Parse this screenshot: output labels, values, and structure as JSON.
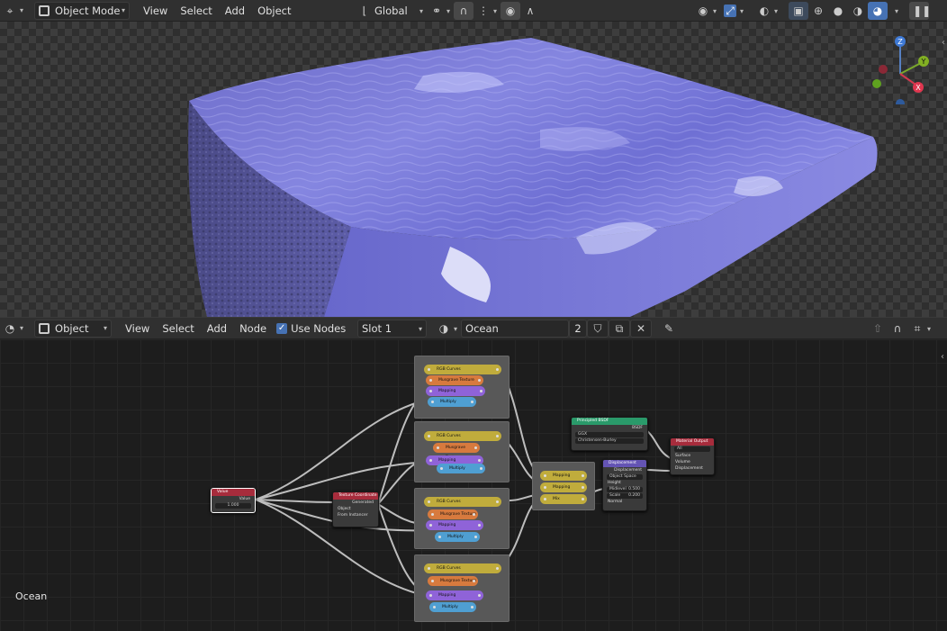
{
  "top_toolbar": {
    "editor_icon": "axis-cross-icon",
    "mode_label": "Object Mode",
    "menu": [
      "View",
      "Select",
      "Add",
      "Object"
    ],
    "transform_orientation": "Global"
  },
  "node_toolbar": {
    "mode_label": "Object",
    "menu": [
      "View",
      "Select",
      "Add",
      "Node"
    ],
    "use_nodes_label": "Use Nodes",
    "use_nodes_checked": true,
    "slot_label": "Slot 1",
    "material_name": "Ocean",
    "user_count": "2"
  },
  "node_editor": {
    "material_label": "Ocean",
    "colors": {
      "color_ramp": "#c0ac3c",
      "mix": "#d77a3e",
      "mapping": "#8f63d8",
      "math": "#4f9fd2"
    },
    "frame_nodes": [
      "RGB Curves",
      "Musgrave Texture",
      "Mapping",
      "Multiply"
    ],
    "value_node": {
      "title": "Value",
      "output": "Value",
      "value": "1.000"
    },
    "texture_coord_node": {
      "title": "Texture Coordinate",
      "output": "Generated",
      "object_label": "Object",
      "instancer_label": "From Instancer"
    },
    "mix_node": {
      "items": [
        "Mapping",
        "Mapping",
        "Mix"
      ]
    },
    "principled_node": {
      "title": "Principled BSDF",
      "output": "BSDF",
      "distribution": "GGX",
      "subsurface": "Christensen-Burley"
    },
    "displacement_node": {
      "title": "Displacement",
      "output": "Displacement",
      "space": "Object Space",
      "inputs": [
        "Height",
        "Midlevel",
        "Scale",
        "Normal"
      ],
      "midlevel": "0.500",
      "scale": "0.200"
    },
    "output_node": {
      "title": "Material Output",
      "target": "All",
      "inputs": [
        "Surface",
        "Volume",
        "Displacement"
      ]
    }
  },
  "gizmo": {
    "axes": [
      "Z",
      "Y",
      "X"
    ]
  }
}
